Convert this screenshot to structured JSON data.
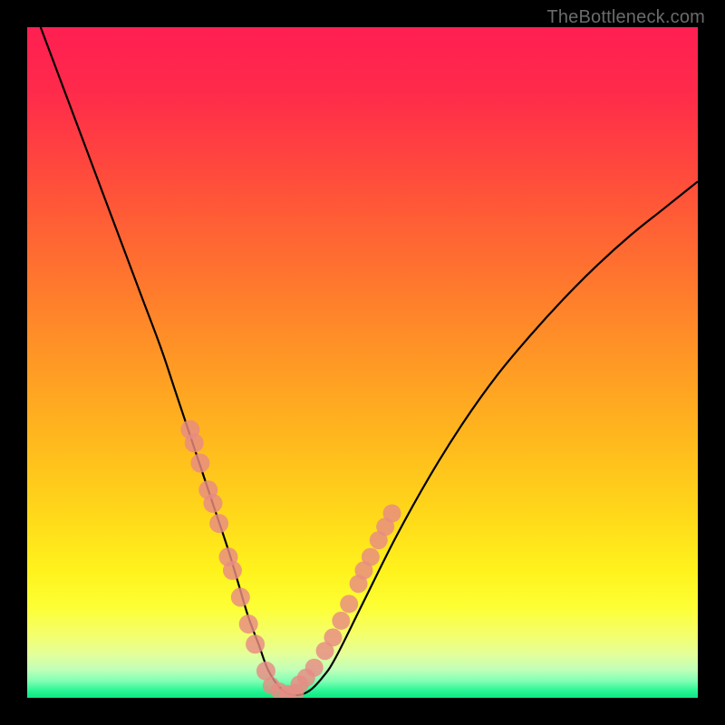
{
  "watermark": "TheBottleneck.com",
  "chart_data": {
    "type": "line",
    "title": "",
    "xlabel": "",
    "ylabel": "",
    "xlim": [
      0,
      100
    ],
    "ylim": [
      0,
      100
    ],
    "series": [
      {
        "name": "bottleneck-curve",
        "x": [
          2,
          5,
          8,
          11,
          14,
          17,
          20,
          22,
          24,
          26,
          28,
          30,
          31.5,
          33,
          34.5,
          36,
          38,
          40,
          42,
          44,
          46,
          50,
          55,
          60,
          65,
          70,
          75,
          80,
          85,
          90,
          95,
          100
        ],
        "y": [
          100,
          92,
          84,
          76,
          68,
          60,
          52,
          46,
          40,
          34,
          28,
          22,
          17,
          12,
          8,
          4,
          1.2,
          0.4,
          1.0,
          3,
          6,
          14,
          24,
          33,
          41,
          48,
          54,
          59.5,
          64.5,
          69,
          73,
          77
        ]
      }
    ],
    "markers_left": [
      {
        "x": 24.3,
        "y": 40
      },
      {
        "x": 24.9,
        "y": 38
      },
      {
        "x": 25.8,
        "y": 35
      },
      {
        "x": 27.0,
        "y": 31
      },
      {
        "x": 27.7,
        "y": 29
      },
      {
        "x": 28.6,
        "y": 26
      },
      {
        "x": 30.0,
        "y": 21
      },
      {
        "x": 30.6,
        "y": 19
      },
      {
        "x": 31.8,
        "y": 15
      },
      {
        "x": 33.0,
        "y": 11
      },
      {
        "x": 34.0,
        "y": 8
      },
      {
        "x": 35.6,
        "y": 4
      }
    ],
    "markers_right": [
      {
        "x": 40.6,
        "y": 2
      },
      {
        "x": 41.6,
        "y": 3
      },
      {
        "x": 42.8,
        "y": 4.5
      },
      {
        "x": 44.4,
        "y": 7
      },
      {
        "x": 45.6,
        "y": 9
      },
      {
        "x": 46.8,
        "y": 11.5
      },
      {
        "x": 48.0,
        "y": 14
      },
      {
        "x": 49.4,
        "y": 17
      },
      {
        "x": 50.2,
        "y": 19
      },
      {
        "x": 51.2,
        "y": 21
      },
      {
        "x": 52.4,
        "y": 23.5
      },
      {
        "x": 53.4,
        "y": 25.5
      },
      {
        "x": 54.4,
        "y": 27.5
      }
    ],
    "markers_bottom": [
      {
        "x": 36.4,
        "y": 1.8
      },
      {
        "x": 37.6,
        "y": 1.0
      },
      {
        "x": 38.8,
        "y": 0.6
      },
      {
        "x": 40.0,
        "y": 0.8
      }
    ],
    "gradient_stops": [
      {
        "offset": 0,
        "color": "#ff1f52"
      },
      {
        "offset": 0.1,
        "color": "#ff2b4a"
      },
      {
        "offset": 0.22,
        "color": "#ff4b3c"
      },
      {
        "offset": 0.35,
        "color": "#ff6f30"
      },
      {
        "offset": 0.48,
        "color": "#ff9326"
      },
      {
        "offset": 0.6,
        "color": "#ffb41e"
      },
      {
        "offset": 0.72,
        "color": "#ffd61a"
      },
      {
        "offset": 0.81,
        "color": "#fff21c"
      },
      {
        "offset": 0.865,
        "color": "#fdff34"
      },
      {
        "offset": 0.905,
        "color": "#f4ff6a"
      },
      {
        "offset": 0.935,
        "color": "#e4ff9a"
      },
      {
        "offset": 0.958,
        "color": "#c0ffb8"
      },
      {
        "offset": 0.975,
        "color": "#80ffb4"
      },
      {
        "offset": 0.99,
        "color": "#26f593"
      },
      {
        "offset": 1.0,
        "color": "#0fe683"
      }
    ]
  }
}
